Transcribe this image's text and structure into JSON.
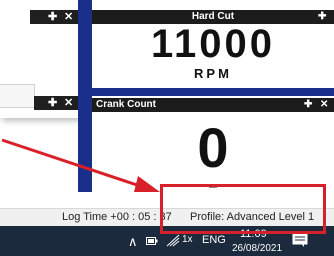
{
  "left_panel_bars": [
    {
      "pin": "✚",
      "close": "✕"
    },
    {
      "pin": "✚",
      "close": "✕"
    }
  ],
  "hard_cut": {
    "title": "Hard Cut",
    "pin": "✚",
    "value": "11000",
    "unit": "RPM"
  },
  "crank_count": {
    "title": "Crank Count",
    "pin": "✚",
    "close": "✕",
    "value": "0",
    "sub": "–"
  },
  "status": {
    "log_time": "Log Time +00 : 05 : 37",
    "profile": "Profile: Advanced Level 1"
  },
  "taskbar": {
    "chevron": "∧",
    "zoom": "1x",
    "language": "ENG",
    "time": "11:09",
    "date": "26/08/2021",
    "notification_icon": "notification-icon"
  },
  "colors": {
    "frame_blue": "#1a2f8a",
    "highlight_red": "#d8202a",
    "taskbar": "#1b2a3c"
  }
}
